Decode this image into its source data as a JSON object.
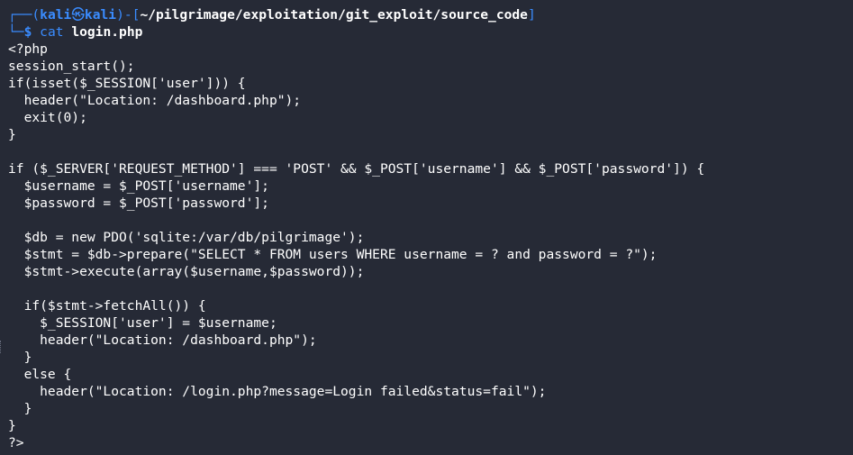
{
  "prompt": {
    "corner_top": "┌──(",
    "user": "kali",
    "at_symbol": "㉿",
    "host": "kali",
    "bracket_mid": ")-[",
    "path": "~/pilgrimage/exploitation/git_exploit/source_code",
    "bracket_end": "]",
    "corner_bottom": "└─",
    "dollar": "$",
    "command": "cat",
    "argument": "login.php"
  },
  "code_lines": [
    "<?php",
    "session_start();",
    "if(isset($_SESSION['user'])) {",
    "  header(\"Location: /dashboard.php\");",
    "  exit(0);",
    "}",
    "",
    "if ($_SERVER['REQUEST_METHOD'] === 'POST' && $_POST['username'] && $_POST['password']) {",
    "  $username = $_POST['username'];",
    "  $password = $_POST['password'];",
    "",
    "  $db = new PDO('sqlite:/var/db/pilgrimage');",
    "  $stmt = $db->prepare(\"SELECT * FROM users WHERE username = ? and password = ?\");",
    "  $stmt->execute(array($username,$password));",
    "",
    "  if($stmt->fetchAll()) {",
    "    $_SESSION['user'] = $username;",
    "    header(\"Location: /dashboard.php\");",
    "  }",
    "  else {",
    "    header(\"Location: /login.php?message=Login failed&status=fail\");",
    "  }",
    "}",
    "?>"
  ]
}
